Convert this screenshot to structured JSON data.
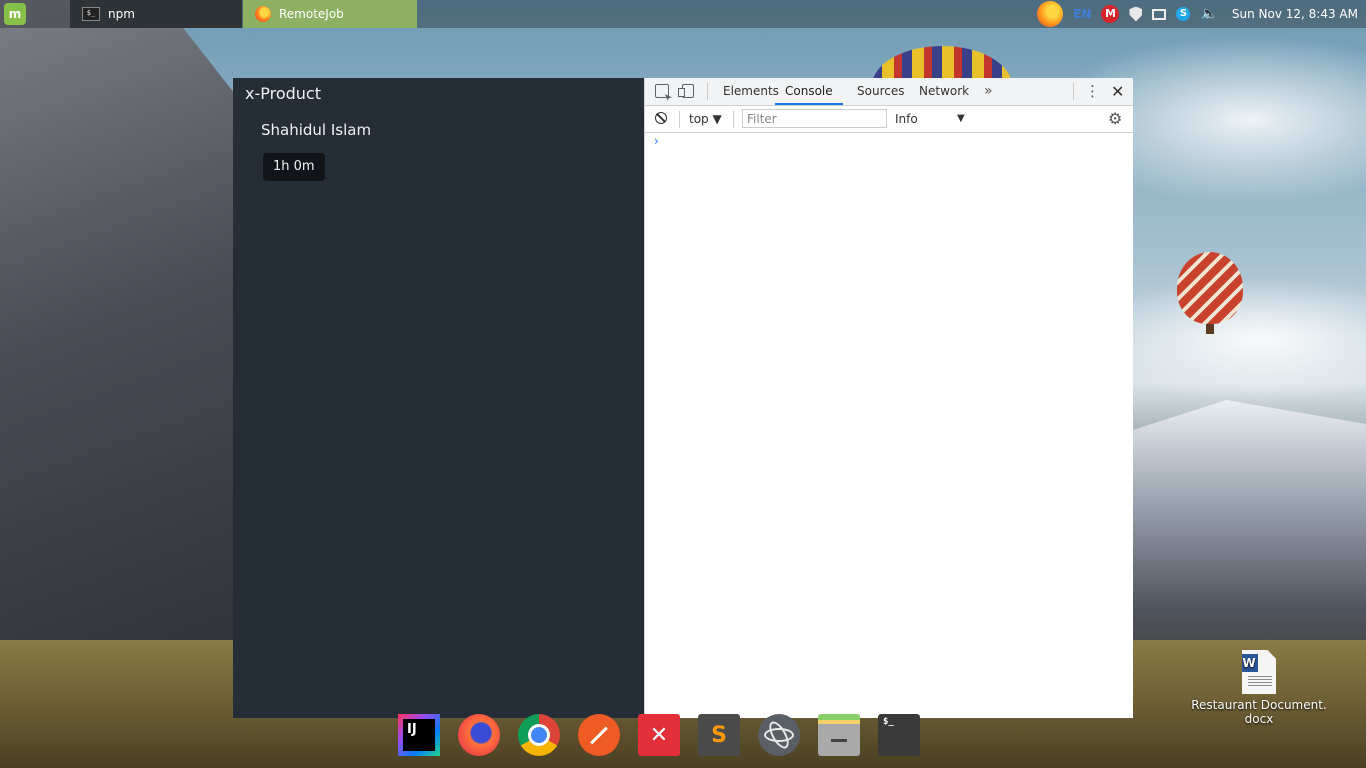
{
  "top_panel": {
    "taskbar": [
      {
        "label": "npm",
        "icon": "terminal-icon"
      },
      {
        "label": "RemoteJob",
        "icon": "firefox-icon"
      }
    ],
    "tray": {
      "language": "EN",
      "mail_badge": "M",
      "skype_badge": "S",
      "clock": "Sun Nov 12,  8:43 AM"
    }
  },
  "app": {
    "title": "x-Product",
    "user_name": "Shahidul Islam",
    "timer": "1h 0m"
  },
  "devtools": {
    "tabs": [
      "Elements",
      "Console",
      "Sources",
      "Network"
    ],
    "active_tab": "Console",
    "more_tabs": "»",
    "context": "top ▼",
    "filter_placeholder": "Filter",
    "level": "Info",
    "level_arrow": "▼",
    "prompt": "›"
  },
  "dock": {
    "items": [
      {
        "name": "intellij-idea",
        "glyph": "IJ"
      },
      {
        "name": "firefox",
        "glyph": ""
      },
      {
        "name": "chrome",
        "glyph": ""
      },
      {
        "name": "postman",
        "glyph": ""
      },
      {
        "name": "xmind",
        "glyph": "✕"
      },
      {
        "name": "sublime-text",
        "glyph": "S"
      },
      {
        "name": "atom",
        "glyph": ""
      },
      {
        "name": "files",
        "glyph": ""
      },
      {
        "name": "terminal",
        "glyph": "$_"
      }
    ]
  },
  "desktop": {
    "file_label_line1": "Restaurant Document.",
    "file_label_line2": "docx"
  }
}
